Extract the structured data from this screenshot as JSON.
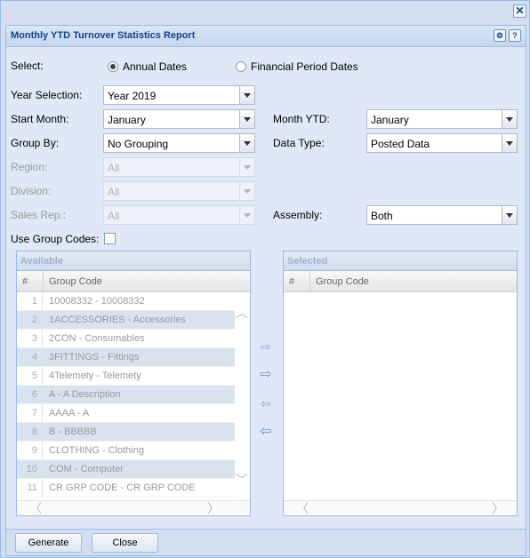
{
  "window": {
    "close_glyph": "✕"
  },
  "panel": {
    "title": "Monthly YTD Turnover Statistics Report",
    "gear_glyph": "⚙",
    "help_glyph": "?"
  },
  "form": {
    "select_label": "Select:",
    "radio_annual": "Annual Dates",
    "radio_financial": "Financial Period Dates",
    "year_label": "Year Selection:",
    "year_value": "Year 2019",
    "start_month_label": "Start Month:",
    "start_month_value": "January",
    "month_ytd_label": "Month YTD:",
    "month_ytd_value": "January",
    "group_by_label": "Group By:",
    "group_by_value": "No Grouping",
    "data_type_label": "Data Type:",
    "data_type_value": "Posted Data",
    "region_label": "Region:",
    "region_value": "All",
    "division_label": "Division:",
    "division_value": "All",
    "sales_rep_label": "Sales Rep.:",
    "sales_rep_value": "All",
    "assembly_label": "Assembly:",
    "assembly_value": "Both",
    "use_group_codes_label": "Use Group Codes:"
  },
  "available": {
    "title": "Available",
    "col_num": "#",
    "col_code": "Group Code",
    "rows": [
      {
        "n": "1",
        "code": "10008332 - 10008332"
      },
      {
        "n": "2",
        "code": "1ACCESSORIES - Accessories"
      },
      {
        "n": "3",
        "code": "2CON - Consumables"
      },
      {
        "n": "4",
        "code": "3FITTINGS - Fittings"
      },
      {
        "n": "5",
        "code": "4Telemety - Telemety"
      },
      {
        "n": "6",
        "code": "A - A Description"
      },
      {
        "n": "7",
        "code": "AAAA - A"
      },
      {
        "n": "8",
        "code": "B - BBBBB"
      },
      {
        "n": "9",
        "code": "CLOTHING - Clothing"
      },
      {
        "n": "10",
        "code": "COM - Computer"
      },
      {
        "n": "11",
        "code": "CR GRP CODE - CR GRP CODE"
      }
    ]
  },
  "selected": {
    "title": "Selected",
    "col_num": "#",
    "col_code": "Group Code"
  },
  "transfer": {
    "add_one": "⇨",
    "add_all": "⇨",
    "remove_one": "⇦",
    "remove_all": "⇦"
  },
  "scroll": {
    "up": "︿",
    "down": "﹀",
    "left": "〈",
    "right": "〉"
  },
  "buttons": {
    "generate": "Generate",
    "close": "Close"
  }
}
